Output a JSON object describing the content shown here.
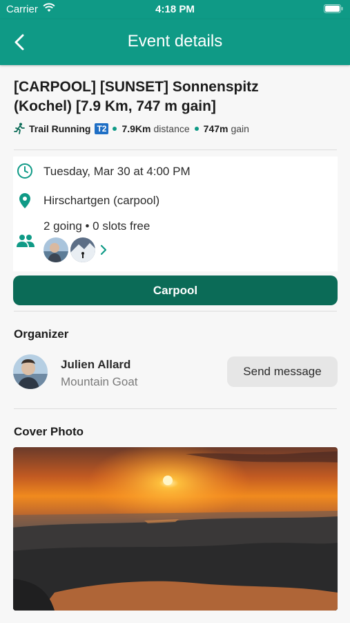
{
  "status_bar": {
    "carrier": "Carrier",
    "time": "4:18 PM"
  },
  "nav": {
    "title": "Event details"
  },
  "event": {
    "title_line1": "[CARPOOL] [SUNSET] Sonnenspitz",
    "title_line2": "(Kochel) [7.9 Km, 747 m gain]",
    "activity": "Trail Running",
    "difficulty": "T2",
    "distance_value": "7.9Km",
    "distance_label": "distance",
    "gain_value": "747m",
    "gain_label": "gain",
    "datetime": "Tuesday, Mar 30 at 4:00 PM",
    "location": "Hirschartgen (carpool)",
    "attendance": "2 going • 0 slots free"
  },
  "actions": {
    "carpool_label": "Carpool",
    "send_message_label": "Send message"
  },
  "organizer": {
    "section_title": "Organizer",
    "name": "Julien Allard",
    "role": "Mountain Goat"
  },
  "cover": {
    "section_title": "Cover Photo"
  },
  "icons": {
    "back": "chevron-left-icon",
    "activity": "runner-icon",
    "time": "clock-icon",
    "location": "map-pin-icon",
    "people": "people-icon",
    "more": "chevron-right-icon"
  },
  "colors": {
    "primary": "#0f9a86",
    "button_dark": "#0b6b57",
    "tag_blue": "#1f6fc5"
  }
}
